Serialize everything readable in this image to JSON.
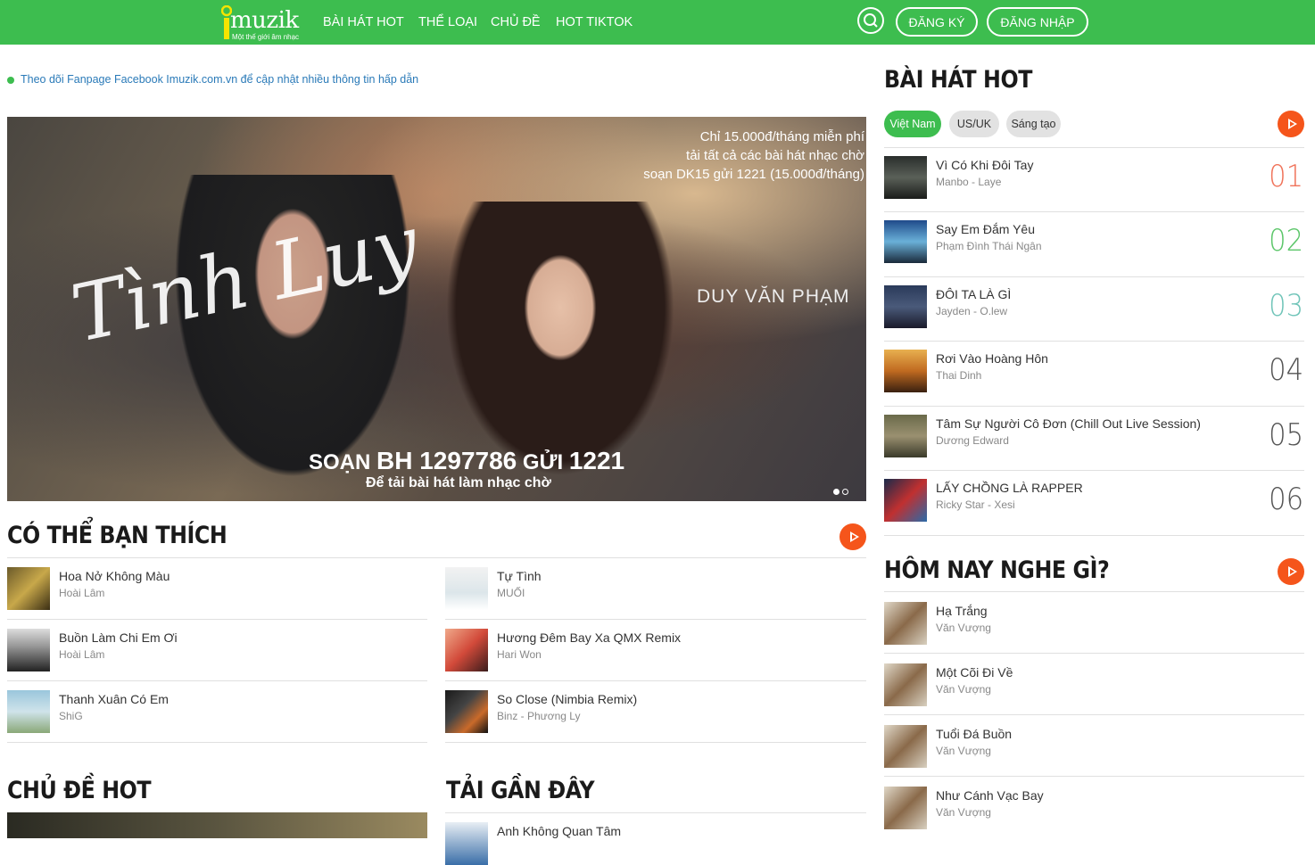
{
  "header": {
    "logo_word": "muzik",
    "logo_tagline": "Một thế giới âm nhạc",
    "nav": [
      "BÀI HÁT HOT",
      "THỂ LOẠI",
      "CHỦ ĐỀ",
      "HOT TIKTOK"
    ],
    "register_label": "ĐĂNG KÝ",
    "login_label": "ĐĂNG NHẬP",
    "brand_color": "#3dbd4f"
  },
  "notice": "Theo dõi Fanpage Facebook Imuzik.com.vn để cập nhật nhiều thông tin hấp dẫn",
  "banner": {
    "promo_line1": "Chỉ 15.000đ/tháng miễn phí",
    "promo_line2": "tải tất cả các bài hát nhạc chờ",
    "promo_line3": "soạn DK15 gửi 1221 (15.000đ/tháng)",
    "artist": "DUY VĂN PHẠM",
    "song_script": "Tình Luy",
    "code_prefix": "SOẠN",
    "code_main": "BH 1297786",
    "code_mid": "GỬI",
    "code_number": "1221",
    "code_sub": "Để tải bài hát làm nhạc chờ"
  },
  "like_section": {
    "title": "CÓ THỂ BẠN THÍCH",
    "left": [
      {
        "title": "Hoa Nở Không Màu",
        "artist": "Hoài Lâm"
      },
      {
        "title": "Buồn Làm Chi Em Ơi",
        "artist": "Hoài Lâm"
      },
      {
        "title": "Thanh Xuân Có Em",
        "artist": "ShiG"
      }
    ],
    "right": [
      {
        "title": "Tự Tình",
        "artist": "MUỐI"
      },
      {
        "title": "Hương Đêm Bay Xa QMX Remix",
        "artist": "Hari Won"
      },
      {
        "title": "So Close (Nimbia Remix)",
        "artist": "Binz - Phương Ly"
      }
    ]
  },
  "topics_title": "CHỦ ĐỀ HOT",
  "recent": {
    "title": "TẢI GẦN ĐÂY",
    "first_song": "Anh Không Quan Tâm"
  },
  "hot_songs": {
    "title": "BÀI HÁT HOT",
    "tabs": [
      "Việt Nam",
      "US/UK",
      "Sáng tạo"
    ],
    "active_tab": "Việt Nam",
    "items": [
      {
        "rank": "01",
        "title": "Vì Có Khi Đôi Tay",
        "artist": "Manbo - Laye",
        "rank_color": "#f0735a"
      },
      {
        "rank": "02",
        "title": "Say Em Đắm Yêu",
        "artist": "Phạm Đình Thái Ngân",
        "rank_color": "#5cc66a"
      },
      {
        "rank": "03",
        "title": "ĐÔI TA LÀ GÌ",
        "artist": "Jayden - O.lew",
        "rank_color": "#6fc4b8"
      },
      {
        "rank": "04",
        "title": "Rơi Vào Hoàng Hôn",
        "artist": "Thai Dinh",
        "rank_color": "#555555"
      },
      {
        "rank": "05",
        "title": "Tâm Sự Người Cô Đơn (Chill Out Live Session)",
        "artist": "Dương Edward",
        "rank_color": "#555555"
      },
      {
        "rank": "06",
        "title": "LẤY CHỒNG LÀ RAPPER",
        "artist": "Ricky Star - Xesi",
        "rank_color": "#555555"
      }
    ]
  },
  "today": {
    "title": "HÔM NAY NGHE GÌ?",
    "items": [
      {
        "title": "Hạ Trắng",
        "artist": "Văn Vượng"
      },
      {
        "title": "Một Cõi Đi Về",
        "artist": "Văn Vượng"
      },
      {
        "title": "Tuổi Đá Buồn",
        "artist": "Văn Vượng"
      },
      {
        "title": "Như Cánh Vạc Bay",
        "artist": "Văn Vượng"
      }
    ]
  },
  "accent_color": "#f5551b"
}
